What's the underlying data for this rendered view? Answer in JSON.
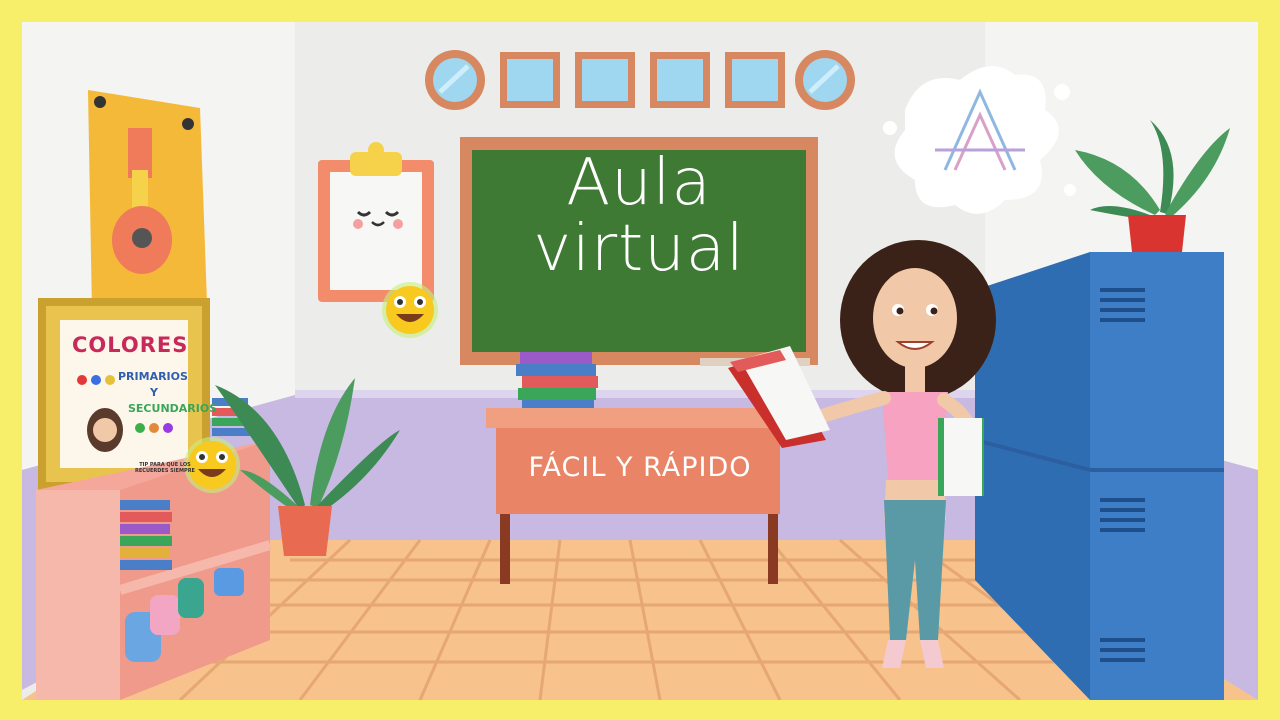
{
  "board": {
    "line1": "Aula",
    "line2": "virtual"
  },
  "desk": {
    "label": "FÁCIL Y RÁPIDO"
  },
  "poster": {
    "title": "COLORES",
    "primary": "PRIMARIOS",
    "y": "Y",
    "secondary": "SECUNDARIOS",
    "tip": "TIP PARA QUE LOS RECUERDES SIEMPRE"
  },
  "logo": {
    "icon": "triangle-a-logo-icon"
  },
  "colors": {
    "frame_yellow": "#f7ee6a",
    "wall": "#ececea",
    "wainscot": "#c8b9e2",
    "floor": "#f7c28c",
    "chalkboard": "#3f7a35",
    "board_frame": "#d88860",
    "desk": "#e98466",
    "lockers": "#3d7ec7",
    "shelf": "#f4a79a"
  }
}
